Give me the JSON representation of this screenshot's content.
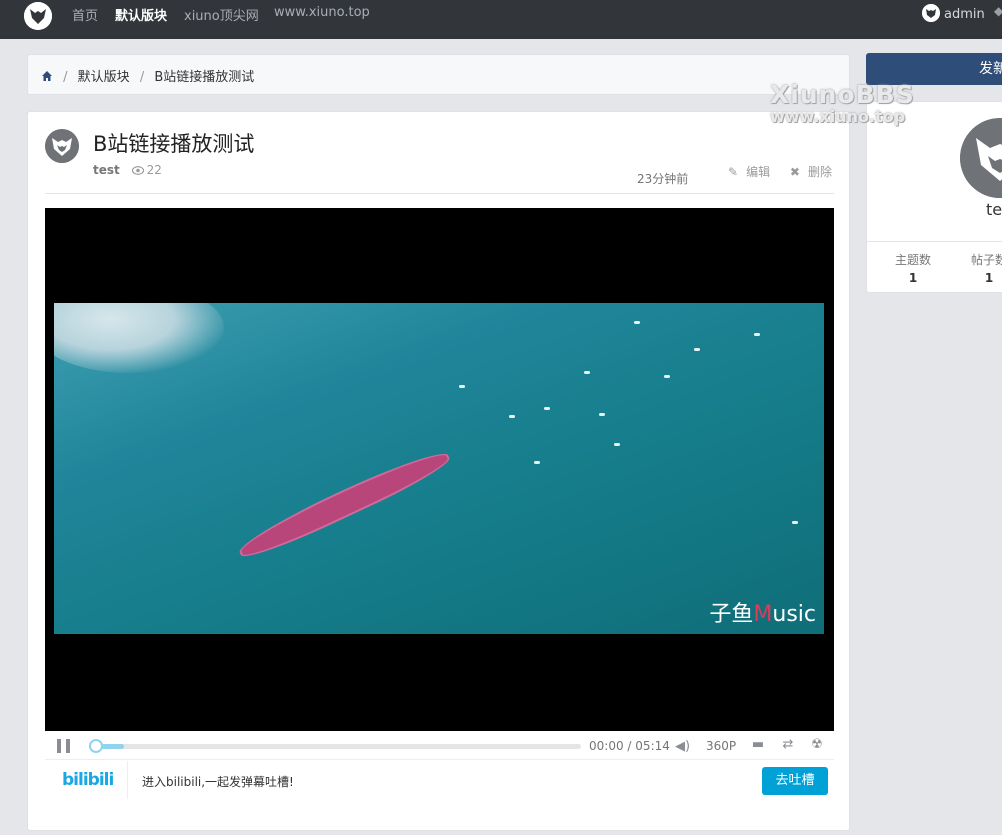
{
  "navbar": {
    "links": [
      "首页",
      "默认版块",
      "xiuno顶尖网",
      "www.xiuno.top"
    ],
    "user": "admin"
  },
  "breadcrumb": {
    "items": [
      "默认版块",
      "B站链接播放测试"
    ]
  },
  "post": {
    "title": "B站链接播放测试",
    "author": "test",
    "time": "23分钟前",
    "views": "22",
    "edit_label": "编辑",
    "delete_label": "删除"
  },
  "player": {
    "video_watermark": "子鱼",
    "video_watermark_m": "M",
    "video_watermark_rest": "usic",
    "current_time": "00:00",
    "duration": "05:14",
    "time_separator": "/",
    "quality": "360P",
    "progress_fraction": 0.0,
    "buffered_fraction": 0.06
  },
  "bilibili": {
    "logo": "bilibili",
    "prompt": "进入bilibili,一起发弹幕吐槽!",
    "button": "去吐槽"
  },
  "sidebar": {
    "new_button": "发新",
    "username": "te",
    "stats": [
      {
        "label": "主题数",
        "value": "1"
      },
      {
        "label": "帖子数",
        "value": "1"
      }
    ]
  },
  "watermark": {
    "line1": "XiunoBBS",
    "line2": "www.xiuno.top"
  },
  "colors": {
    "navbar": "#32363b",
    "accent": "#00a1d6",
    "new_button": "#2e4d79"
  }
}
